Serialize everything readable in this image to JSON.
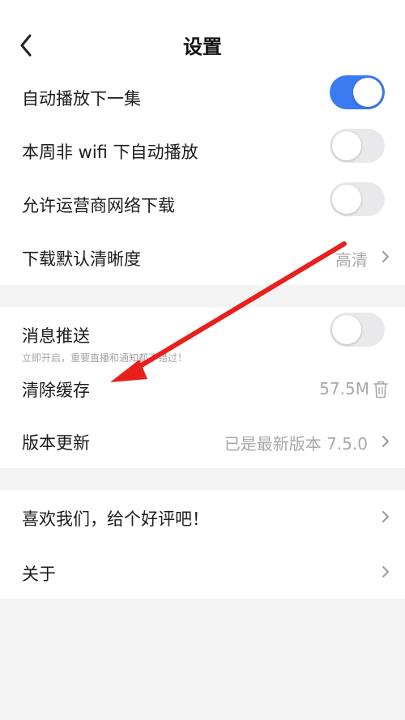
{
  "header": {
    "title": "设置",
    "back_icon": "chevron-left-icon"
  },
  "section1": {
    "autoplay_next": {
      "label": "自动播放下一集",
      "enabled": true
    },
    "weekly_nonwifi_autoplay": {
      "label": "本周非 wifi 下自动播放",
      "enabled": false
    },
    "carrier_download": {
      "label": "允许运营商网络下载",
      "enabled": false
    },
    "download_quality": {
      "label": "下载默认清晰度",
      "value": "高清"
    }
  },
  "section2": {
    "push": {
      "label": "消息推送",
      "subtitle": "立即开启，重要直播和通知都不错过！",
      "enabled": false
    },
    "clear_cache": {
      "label": "清除缓存",
      "value": "57.5M",
      "icon": "trash-icon"
    },
    "version": {
      "label": "版本更新",
      "value": "已是最新版本 7.5.0"
    }
  },
  "section3": {
    "rate_us": {
      "label": "喜欢我们，给个好评吧！"
    },
    "about": {
      "label": "关于"
    }
  },
  "colors": {
    "accent": "#3a7bf2",
    "annotation_arrow": "#e8201c",
    "background": "#f3f3f3"
  }
}
